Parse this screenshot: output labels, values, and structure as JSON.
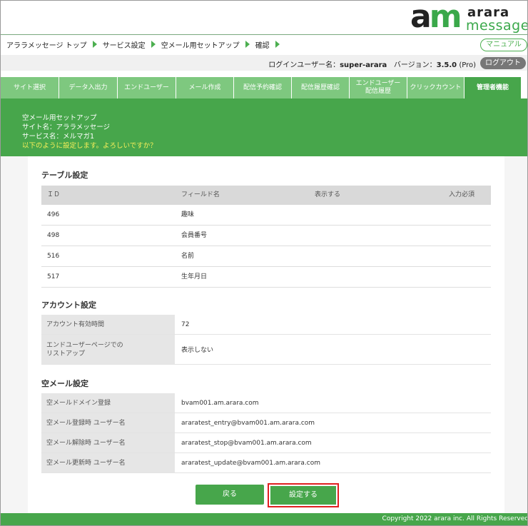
{
  "logo": {
    "mark_a": "a",
    "mark_m": "m",
    "word1": "arara",
    "word2": "message"
  },
  "breadcrumb": [
    "アララメッセージ トップ",
    "サービス設定",
    "空メール用セットアップ",
    "確認"
  ],
  "manual_label": "マニュアル",
  "user_bar": {
    "login_label": "ログインユーザー名：",
    "login_user": "super-arara",
    "version_label": "バージョン：",
    "version": "3.5.0",
    "edition": "(Pro)",
    "logout_label": "ログアウト"
  },
  "tabs": [
    {
      "label": "サイト選択"
    },
    {
      "label": "データ入出力"
    },
    {
      "label": "エンドユーザー"
    },
    {
      "label": "メール作成"
    },
    {
      "label": "配信予約確認"
    },
    {
      "label": "配信履歴確認"
    },
    {
      "label": "エンドユーザー\n配信履歴"
    },
    {
      "label": "クリックカウント"
    },
    {
      "label": "管理者機能"
    }
  ],
  "notice": {
    "line1": "空メール用セットアップ",
    "line2": "サイト名：アララメッセージ",
    "line3": "サービス名：メルマガ1",
    "confirm": "以下のように設定します。よろしいですか？"
  },
  "table_section": {
    "title": "テーブル設定",
    "columns": [
      "ＩＤ",
      "フィールド名",
      "表示する",
      "入力必須"
    ],
    "rows": [
      {
        "id": "496",
        "field": "趣味"
      },
      {
        "id": "498",
        "field": "会員番号"
      },
      {
        "id": "516",
        "field": "名前"
      },
      {
        "id": "517",
        "field": "生年月日"
      }
    ]
  },
  "account_section": {
    "title": "アカウント設定",
    "rows": [
      {
        "key": "アカウント有効時間",
        "value": "72"
      },
      {
        "key": "エンドユーザーページでの\nリストアップ",
        "value": "表示しない"
      }
    ]
  },
  "mail_section": {
    "title": "空メール設定",
    "rows": [
      {
        "key": "空メールドメイン登録",
        "value": "bvam001.am.arara.com"
      },
      {
        "key": "空メール登録時 ユーザー名",
        "value": "araratest_entry@bvam001.am.arara.com"
      },
      {
        "key": "空メール解除時 ユーザー名",
        "value": "araratest_stop@bvam001.am.arara.com"
      },
      {
        "key": "空メール更新時 ユーザー名",
        "value": "araratest_update@bvam001.am.arara.com"
      }
    ]
  },
  "buttons": {
    "back": "戻る",
    "submit": "設定する"
  },
  "footer": "Copyright 2022 arara inc. All Rights Reserved",
  "colors": {
    "brand_green": "#47a64b",
    "tab_green": "#7ec87f",
    "highlight_red": "#e02020",
    "warning_yellow": "#f6ee5a"
  }
}
